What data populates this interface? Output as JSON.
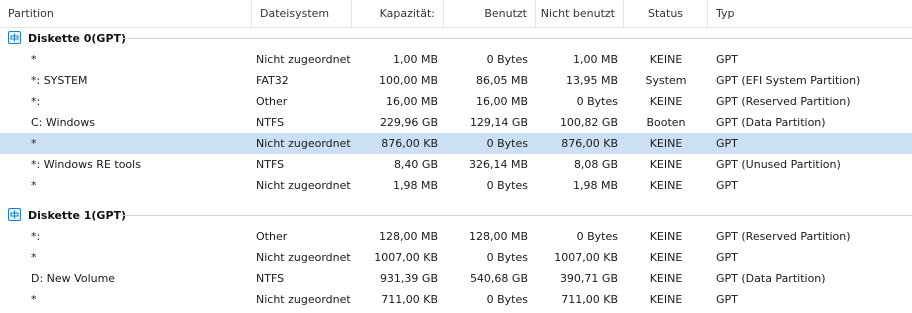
{
  "columns": {
    "partition": "Partition",
    "filesystem": "Dateisystem",
    "capacity": "Kapazität:",
    "used": "Benutzt",
    "unused": "Nicht benutzt",
    "status": "Status",
    "type": "Typ"
  },
  "colors": {
    "selected_row": "#cce0f5",
    "disk_icon": "#1a7fd0"
  },
  "disks": [
    {
      "name": "Diskette 0(GPT)",
      "icon": "disk-icon",
      "partitions": [
        {
          "name": "*",
          "fs": "Nicht zugeordnet",
          "capacity": "1,00 MB",
          "used": "0 Bytes",
          "unused": "1,00 MB",
          "status": "KEINE",
          "type": "GPT",
          "selected": false
        },
        {
          "name": "*: SYSTEM",
          "fs": "FAT32",
          "capacity": "100,00 MB",
          "used": "86,05 MB",
          "unused": "13,95 MB",
          "status": "System",
          "type": "GPT (EFI System Partition)",
          "selected": false
        },
        {
          "name": "*:",
          "fs": "Other",
          "capacity": "16,00 MB",
          "used": "16,00 MB",
          "unused": "0 Bytes",
          "status": "KEINE",
          "type": "GPT (Reserved Partition)",
          "selected": false
        },
        {
          "name": "C: Windows",
          "fs": "NTFS",
          "capacity": "229,96 GB",
          "used": "129,14 GB",
          "unused": "100,82 GB",
          "status": "Booten",
          "type": "GPT (Data Partition)",
          "selected": false
        },
        {
          "name": "*",
          "fs": "Nicht zugeordnet",
          "capacity": "876,00 KB",
          "used": "0 Bytes",
          "unused": "876,00 KB",
          "status": "KEINE",
          "type": "GPT",
          "selected": true
        },
        {
          "name": "*: Windows RE tools",
          "fs": "NTFS",
          "capacity": "8,40 GB",
          "used": "326,14 MB",
          "unused": "8,08 GB",
          "status": "KEINE",
          "type": "GPT (Unused Partition)",
          "selected": false
        },
        {
          "name": "*",
          "fs": "Nicht zugeordnet",
          "capacity": "1,98 MB",
          "used": "0 Bytes",
          "unused": "1,98 MB",
          "status": "KEINE",
          "type": "GPT",
          "selected": false
        }
      ]
    },
    {
      "name": "Diskette 1(GPT)",
      "icon": "disk-icon",
      "partitions": [
        {
          "name": "*:",
          "fs": "Other",
          "capacity": "128,00 MB",
          "used": "128,00 MB",
          "unused": "0 Bytes",
          "status": "KEINE",
          "type": "GPT (Reserved Partition)",
          "selected": false
        },
        {
          "name": "*",
          "fs": "Nicht zugeordnet",
          "capacity": "1007,00 KB",
          "used": "0 Bytes",
          "unused": "1007,00 KB",
          "status": "KEINE",
          "type": "GPT",
          "selected": false
        },
        {
          "name": "D: New Volume",
          "fs": "NTFS",
          "capacity": "931,39 GB",
          "used": "540,68 GB",
          "unused": "390,71 GB",
          "status": "KEINE",
          "type": "GPT (Data Partition)",
          "selected": false
        },
        {
          "name": "*",
          "fs": "Nicht zugeordnet",
          "capacity": "711,00 KB",
          "used": "0 Bytes",
          "unused": "711,00 KB",
          "status": "KEINE",
          "type": "GPT",
          "selected": false
        }
      ]
    }
  ]
}
